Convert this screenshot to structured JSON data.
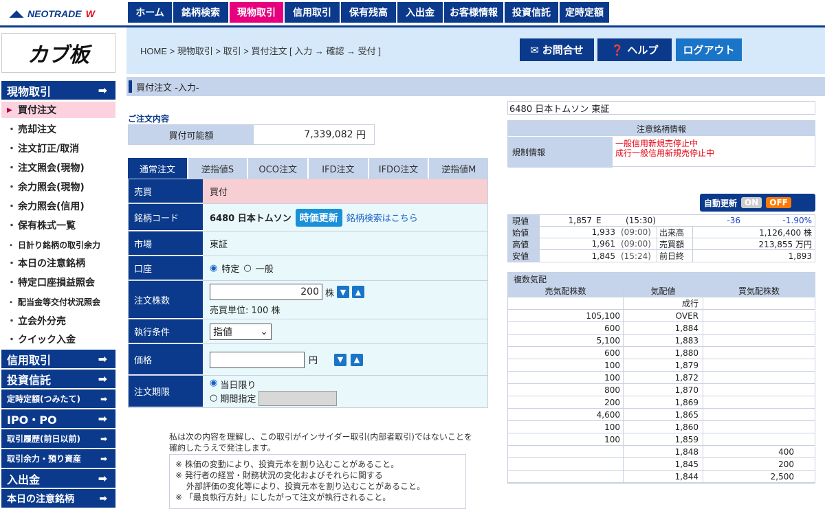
{
  "brand": {
    "logo_text": "NEOTRADE",
    "logo_accent": "W"
  },
  "top_nav": [
    "ホーム",
    "銘柄検索",
    "現物取引",
    "信用取引",
    "保有残高",
    "入出金",
    "お客様情報",
    "投資信託",
    "定時定額"
  ],
  "sidebar": {
    "banner": "カブ板",
    "sections": [
      {
        "label": "現物取引"
      },
      {
        "label": "信用取引"
      },
      {
        "label": "投資信託"
      },
      {
        "label": "定時定額(つみたて)"
      },
      {
        "label": "IPO・PO"
      },
      {
        "label": "取引履歴(前日以前)"
      },
      {
        "label": "取引余力・預り資産"
      },
      {
        "label": "入出金"
      },
      {
        "label": "本日の注意銘柄"
      }
    ],
    "items": [
      "買付注文",
      "売却注文",
      "注文訂正/取消",
      "注文照会(現物)",
      "余力照会(現物)",
      "余力照会(信用)",
      "保有株式一覧",
      "日計り銘柄の取引余力",
      "本日の注意銘柄",
      "特定口座損益照会",
      "配当金等交付状況照会",
      "立会外分売",
      "クイック入金"
    ]
  },
  "header": {
    "breadcrumb": "HOME > 現物取引 > 取引 > 買付注文 [ 入力 → 確認 → 受付 ]",
    "contact": "お問合せ",
    "help": "ヘルプ",
    "logout": "ログアウト",
    "page_subtitle": "買付注文 -入力-"
  },
  "order": {
    "section_title": "ご注文内容",
    "available_label": "買付可能額",
    "available_value": "7,339,082",
    "yen": "円",
    "tabs": [
      "通常注文",
      "逆指値S",
      "OCO注文",
      "IFD注文",
      "IFDO注文",
      "逆指値M"
    ],
    "side_label": "売買",
    "side_value": "買付",
    "code_label": "銘柄コード",
    "code_value": "6480 日本トムソン",
    "refresh_btn": "時価更新",
    "search_link": "銘柄検索はこちら",
    "market_label": "市場",
    "market_value": "東証",
    "account_label": "口座",
    "account_opt1": "特定",
    "account_opt2": "一般",
    "qty_label": "注文株数",
    "qty_value": "200",
    "qty_unit": "株",
    "lot_note": "売買単位: 100 株",
    "exec_label": "執行条件",
    "exec_value": "指値",
    "price_label": "価格",
    "price_value": "",
    "price_unit": "円",
    "period_label": "注文期限",
    "period_opt1": "当日限り",
    "period_opt2": "期間指定"
  },
  "disclaimer": {
    "main": "私は次の内容を理解し、この取引がインサイダー取引(内部者取引)ではないことを確約したうえで発注します。",
    "notes": [
      "※ 株価の変動により、投資元本を割り込むことがあること。",
      "※ 発行者の経営・財務状況の変化およびそれらに関する",
      "　 外部評価の変化等により、投資元本を割り込むことがあること。",
      "※ 「最良執行方針」にしたがって注文が執行されること。"
    ]
  },
  "stock": {
    "title": "6480 日本トムソン 東証",
    "caution_header": "注意銘柄情報",
    "reg_label": "規制情報",
    "reg_lines": [
      "一般信用新規売停止中",
      "成行一般信用新規売停止中"
    ],
    "auto_update": "自動更新",
    "on": "ON",
    "off": "OFF"
  },
  "quote": {
    "current": {
      "label": "現値",
      "price": "1,857",
      "flag": "E",
      "time": "(15:30)",
      "change": "-36",
      "pct": "-1.90%"
    },
    "rows": [
      {
        "label": "始値",
        "price": "1,933",
        "time": "(09:00)",
        "k": "出来高",
        "v": "1,126,400 株"
      },
      {
        "label": "高値",
        "price": "1,961",
        "time": "(09:00)",
        "k": "売買額",
        "v": "213,855 万円"
      },
      {
        "label": "安値",
        "price": "1,845",
        "time": "(15:24)",
        "k": "前日終",
        "v": "1,893"
      }
    ]
  },
  "depth": {
    "title": "複数気配",
    "headers": [
      "売気配株数",
      "気配値",
      "買気配株数"
    ],
    "rows": [
      [
        "",
        "成行",
        ""
      ],
      [
        "105,100",
        "OVER",
        ""
      ],
      [
        "600",
        "1,884",
        ""
      ],
      [
        "5,100",
        "1,883",
        ""
      ],
      [
        "600",
        "1,880",
        ""
      ],
      [
        "100",
        "1,879",
        ""
      ],
      [
        "100",
        "1,872",
        ""
      ],
      [
        "800",
        "1,870",
        ""
      ],
      [
        "200",
        "1,869",
        ""
      ],
      [
        "4,600",
        "1,865",
        ""
      ],
      [
        "100",
        "1,860",
        ""
      ],
      [
        "100",
        "1,859",
        ""
      ],
      [
        "",
        "1,848",
        "400"
      ],
      [
        "",
        "1,845",
        "200"
      ],
      [
        "",
        "1,844",
        "2,500"
      ]
    ]
  }
}
